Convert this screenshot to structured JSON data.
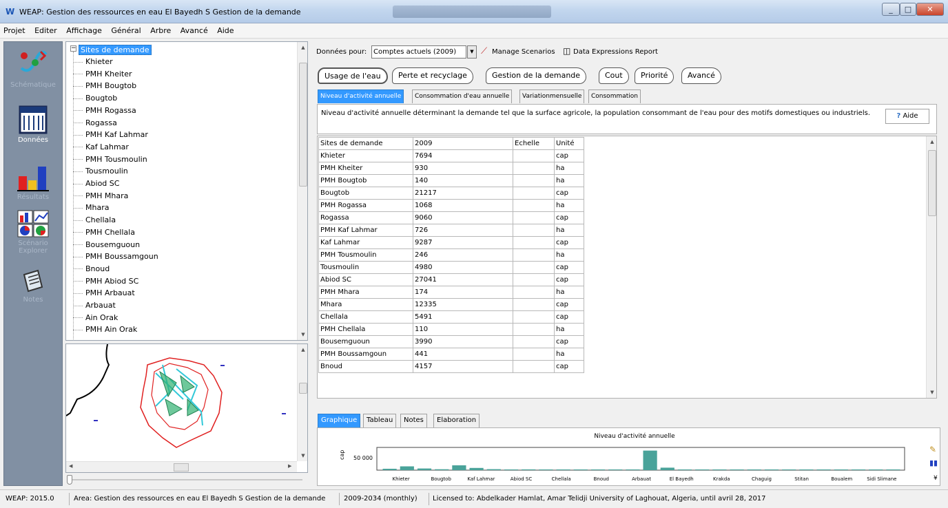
{
  "window": {
    "title": "WEAP: Gestion des ressources en eau El Bayedh S Gestion de la demande"
  },
  "menu": [
    "Projet",
    "Editer",
    "Affichage",
    "Général",
    "Arbre",
    "Avancé",
    "Aide"
  ],
  "views": [
    {
      "label": "Schématique",
      "icon": "schematic-icon",
      "active": false
    },
    {
      "label": "Données",
      "icon": "data-grid-icon",
      "active": true
    },
    {
      "label": "Résultats",
      "icon": "results-chart-icon",
      "active": false
    },
    {
      "label": "Scénario Explorer",
      "icon": "scenario-explorer-icon",
      "active": false
    },
    {
      "label": "Notes",
      "icon": "notes-icon",
      "active": false
    }
  ],
  "tree": {
    "root": "Sites de demande",
    "items": [
      "Khieter",
      "PMH Kheiter",
      "PMH Bougtob",
      "Bougtob",
      "PMH Rogassa",
      "Rogassa",
      "PMH Kaf Lahmar",
      "Kaf Lahmar",
      "PMH Tousmoulin",
      "Tousmoulin",
      "Abiod SC",
      "PMH Mhara",
      "Mhara",
      "Chellala",
      "PMH Chellala",
      "Bousemguoun",
      "PMH Boussamgoun",
      "Bnoud",
      "PMH Abiod SC",
      "PMH Arbauat",
      "Arbauat",
      "Ain Orak",
      "PMH Ain Orak"
    ]
  },
  "data_for": {
    "label": "Données pour:",
    "selected": "Comptes actuels (2009)",
    "manage_scenarios": "Manage Scenarios",
    "report": "Data Expressions Report"
  },
  "main_tabs": [
    "Usage de l'eau",
    "Perte et recyclage",
    "Gestion de la demande",
    "Cout",
    "Priorité",
    "Avancé"
  ],
  "sub_tabs": [
    "Niveau d'activité annuelle",
    "Consommation d'eau annuelle",
    "Variationmensuelle",
    "Consommation"
  ],
  "description": "Niveau d'activité annuelle déterminant la demande tel que la surface agricole, la population consommant de l'eau pour des motifs domestiques ou industriels.",
  "help_label": "Aide",
  "grid": {
    "columns": [
      "Sites de demande",
      "2009",
      "Echelle",
      "Unité"
    ],
    "rows": [
      [
        "Khieter",
        "7694",
        "",
        "cap"
      ],
      [
        "PMH Kheiter",
        "930",
        "",
        "ha"
      ],
      [
        "PMH Bougtob",
        "140",
        "",
        "ha"
      ],
      [
        "Bougtob",
        "21217",
        "",
        "cap"
      ],
      [
        "PMH Rogassa",
        "1068",
        "",
        "ha"
      ],
      [
        "Rogassa",
        "9060",
        "",
        "cap"
      ],
      [
        "PMH Kaf Lahmar",
        "726",
        "",
        "ha"
      ],
      [
        "Kaf Lahmar",
        "9287",
        "",
        "cap"
      ],
      [
        "PMH Tousmoulin",
        "246",
        "",
        "ha"
      ],
      [
        "Tousmoulin",
        "4980",
        "",
        "cap"
      ],
      [
        "Abiod SC",
        "27041",
        "",
        "cap"
      ],
      [
        "PMH Mhara",
        "174",
        "",
        "ha"
      ],
      [
        "Mhara",
        "12335",
        "",
        "cap"
      ],
      [
        "Chellala",
        "5491",
        "",
        "cap"
      ],
      [
        "PMH Chellala",
        "110",
        "",
        "ha"
      ],
      [
        "Bousemguoun",
        "3990",
        "",
        "cap"
      ],
      [
        "PMH Boussamgoun",
        "441",
        "",
        "ha"
      ],
      [
        "Bnoud",
        "4157",
        "",
        "cap"
      ]
    ]
  },
  "bottom_tabs": [
    "Graphique",
    "Tableau",
    "Notes",
    "Elaboration"
  ],
  "chart_data": {
    "type": "bar",
    "title": "Niveau d'activité annuelle",
    "ylabel": "cap",
    "yticks": [
      "50 000"
    ],
    "ylim": [
      0,
      120000
    ],
    "x_labels": [
      "Khieter",
      "Bougtob",
      "Kaf Lahmar",
      "Abiod SC",
      "Chellala",
      "Bnoud",
      "Arbauat",
      "El Bayedh",
      "Krakda",
      "Chaguig",
      "Stitan",
      "Boualem",
      "Sidi Slimane"
    ],
    "values": [
      7694,
      21217,
      9287,
      4980,
      27041,
      12335,
      5491,
      3990,
      4157,
      2000,
      3000,
      2500,
      1500,
      2000,
      1000,
      110000,
      14000,
      2500,
      3000,
      1200,
      2000,
      1500,
      2500,
      1500,
      1000,
      2000,
      1500,
      800,
      700,
      600
    ],
    "color": "#4aa39a"
  },
  "status": {
    "version": "WEAP: 2015.0",
    "area": "Area: Gestion des ressources en eau El Bayedh S Gestion de la demande",
    "period": "2009-2034 (monthly)",
    "license": "Licensed to: Abdelkader Hamlat, Amar Telidji University of Laghouat, Algeria, until avril 28, 2017"
  }
}
